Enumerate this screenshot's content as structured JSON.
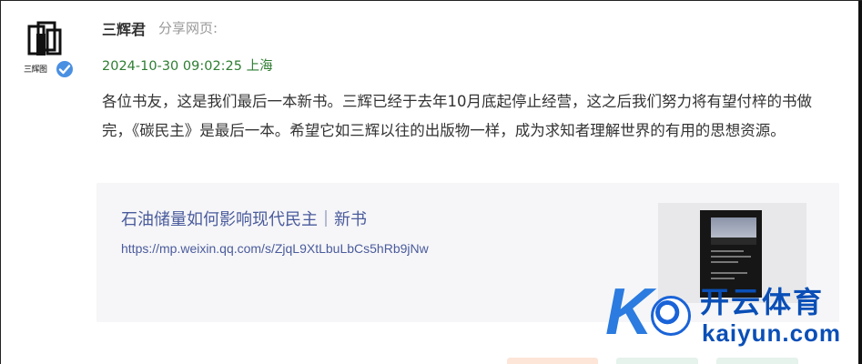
{
  "user": {
    "name": "三辉君",
    "action": "分享网页:",
    "avatar_text": "三辉图"
  },
  "post": {
    "timestamp": "2024-10-30 09:02:25",
    "location": "上海",
    "body": "各位书友，这是我们最后一本新书。三辉已经于去年10月底起停止经营，这之后我们努力将有望付梓的书做完，《碳民主》是最后一本。希望它如三辉以往的出版物一样，成为求知者理解世界的有用的思想资源。"
  },
  "link_card": {
    "title": "石油储量如何影响现代民主｜新书",
    "url": "https://mp.weixin.qq.com/s/ZjqL9XtLbuLbCs5hRb9jNw"
  },
  "watermark": {
    "letter": "K",
    "cn": "开云体育",
    "en": "kaiyun.com"
  },
  "colors": {
    "meta_green": "#2e7d32",
    "link_blue": "#4a5b9c",
    "verified_blue": "#4a90e2",
    "watermark_blue": "#0a4fb7"
  },
  "icons": [
    "verified-badge-icon",
    "publisher-logo-icon",
    "soccer-ball-icon"
  ]
}
